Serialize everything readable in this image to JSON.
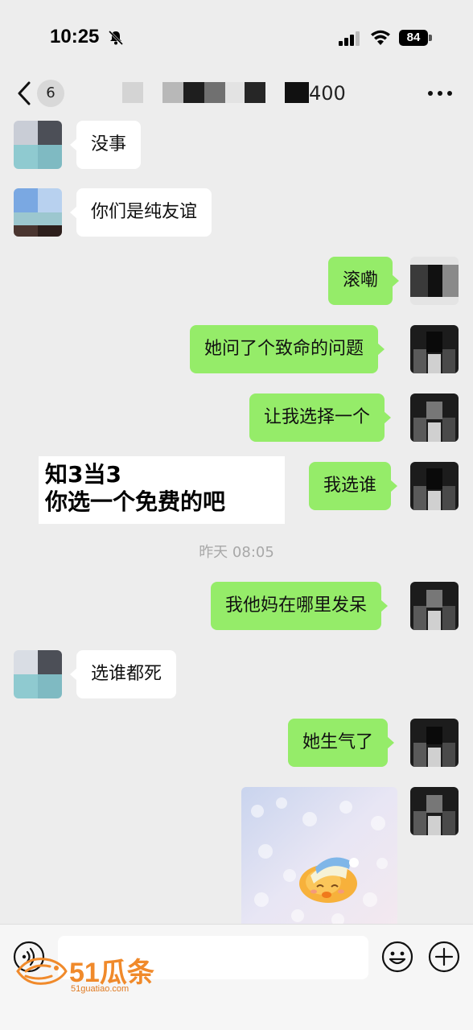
{
  "status_bar": {
    "time": "10:25",
    "battery_level": "84",
    "icons": [
      "bell-muted-icon",
      "signal-icon",
      "wifi-icon",
      "battery-icon"
    ]
  },
  "nav": {
    "unread_count": "6",
    "title_visible_suffix": "400",
    "icons": [
      "chevron-left-icon",
      "more-dots-icon"
    ]
  },
  "messages": [
    {
      "side": "in",
      "text": "没事"
    },
    {
      "side": "in",
      "text": "你们是纯友谊"
    },
    {
      "side": "out",
      "text": "滚嘞"
    },
    {
      "side": "out",
      "text": "她问了个致命的问题"
    },
    {
      "side": "out",
      "text": "让我选择一个"
    },
    {
      "side": "out",
      "text": "我选谁"
    },
    {
      "side": "out",
      "text": "我他妈在哪里发呆"
    },
    {
      "side": "in",
      "text": "选谁都死"
    },
    {
      "side": "out",
      "text": "她生气了"
    },
    {
      "side": "out",
      "type": "sticker",
      "sticker": "duck-sticker"
    }
  ],
  "timestamp": "昨天 08:05",
  "overlay_caption": {
    "line1": "知3当3",
    "line2": "你选一个免费的吧"
  },
  "input_bar": {
    "placeholder": "",
    "icons": [
      "voice-icon",
      "emoji-icon",
      "plus-icon"
    ]
  },
  "watermark": {
    "brand": "51瓜条",
    "url": "51guatiao.com"
  },
  "colors": {
    "background": "#ededed",
    "outgoing_bubble": "#95ec69",
    "incoming_bubble": "#ffffff",
    "watermark": "#f08a2b"
  }
}
